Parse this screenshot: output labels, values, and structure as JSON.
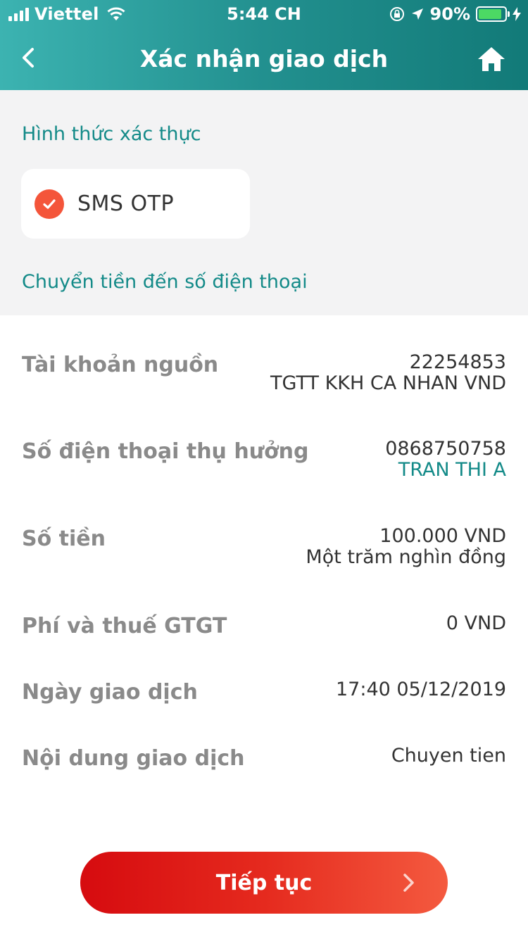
{
  "status_bar": {
    "carrier": "Viettel",
    "time": "5:44 CH",
    "battery": "90%",
    "battery_level": 0.9
  },
  "header": {
    "title": "Xác nhận giao dịch",
    "back_icon": "chevron-left-icon",
    "home_icon": "home-icon"
  },
  "auth": {
    "section_label": "Hình thức xác thực",
    "selected_method": "SMS OTP"
  },
  "transaction": {
    "type_label": "Chuyển tiền đến số điện thoại",
    "rows": [
      {
        "label": "Tài khoản nguồn",
        "value": "22254853",
        "sub": "TGTT KKH CA NHAN VND"
      },
      {
        "label": "Số điện thoại thụ hưởng",
        "value": "0868750758",
        "sub": "TRAN THI A"
      },
      {
        "label": "Số tiền",
        "value": "100.000 VND",
        "sub": "Một trăm nghìn đồng"
      },
      {
        "label": "Phí và thuế GTGT",
        "value": "0 VND"
      },
      {
        "label": "Ngày giao dịch",
        "value": "17:40 05/12/2019"
      },
      {
        "label": "Nội dung giao dịch",
        "value": "Chuyen tien"
      }
    ]
  },
  "actions": {
    "continue_label": "Tiếp tục"
  },
  "colors": {
    "teal": "#138a88",
    "accent_red": "#e52a1e",
    "check_orange": "#f4553a"
  }
}
